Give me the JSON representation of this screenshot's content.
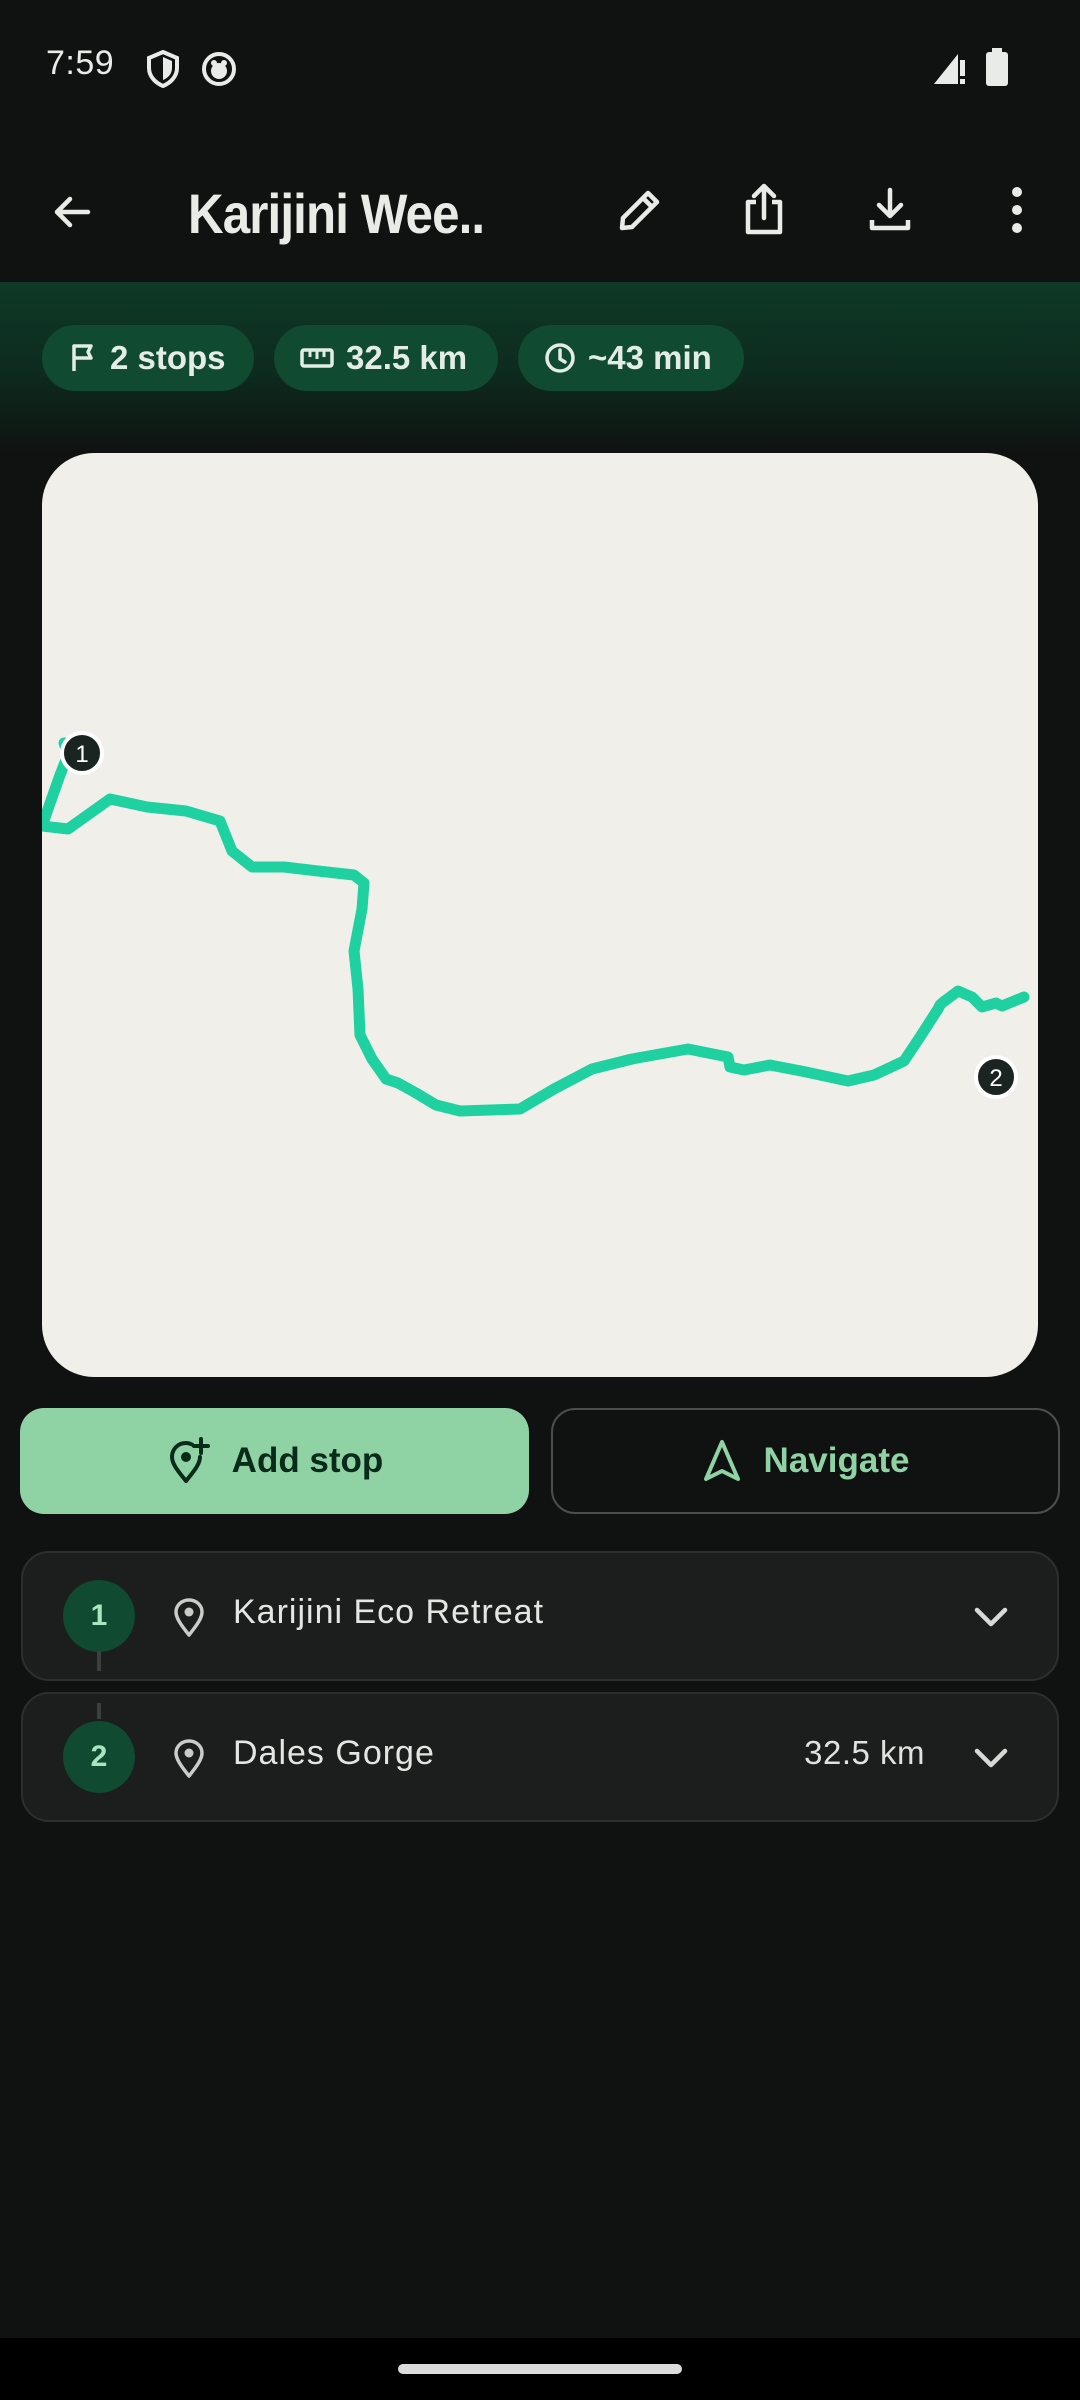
{
  "status_bar": {
    "time": "7:59"
  },
  "app_bar": {
    "title": "Karijini Wee..."
  },
  "stats": {
    "stops": "2 stops",
    "distance": "32.5 km",
    "duration": "~43 min"
  },
  "map": {
    "markers": [
      {
        "label": "1"
      },
      {
        "label": "2"
      }
    ],
    "route_color": "#1fd1a0"
  },
  "actions": {
    "add_stop_label": "Add stop",
    "navigate_label": "Navigate"
  },
  "stops": [
    {
      "number": "1",
      "name": "Karijini Eco Retreat",
      "distance": ""
    },
    {
      "number": "2",
      "name": "Dales Gorge",
      "distance": "32.5 km"
    }
  ],
  "colors": {
    "accent": "#8fd3a5",
    "chip_bg": "#0f4a31",
    "background": "#0f1211",
    "map_bg": "#f1efe9"
  }
}
